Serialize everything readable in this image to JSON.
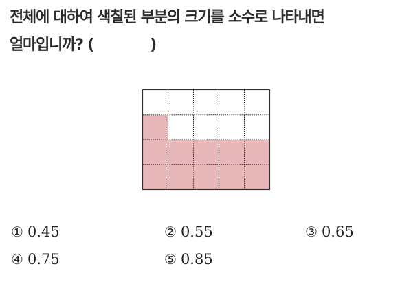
{
  "question": {
    "line1": "전체에 대하여 색칠된 부분의 크기를 소수로 나타내면",
    "line2_prefix": "얼마입니까? (",
    "line2_suffix": ")"
  },
  "figure": {
    "rows": 4,
    "cols": 5,
    "shaded": [
      [
        false,
        false,
        false,
        false,
        false
      ],
      [
        true,
        false,
        false,
        false,
        false
      ],
      [
        true,
        true,
        true,
        true,
        true
      ],
      [
        true,
        true,
        true,
        true,
        true
      ]
    ],
    "shade_color": "#e8b7b9",
    "line_color": "#333333"
  },
  "choices": [
    {
      "mark": "①",
      "value": "0.45"
    },
    {
      "mark": "②",
      "value": "0.55"
    },
    {
      "mark": "③",
      "value": "0.65"
    },
    {
      "mark": "④",
      "value": "0.75"
    },
    {
      "mark": "⑤",
      "value": "0.85"
    }
  ]
}
